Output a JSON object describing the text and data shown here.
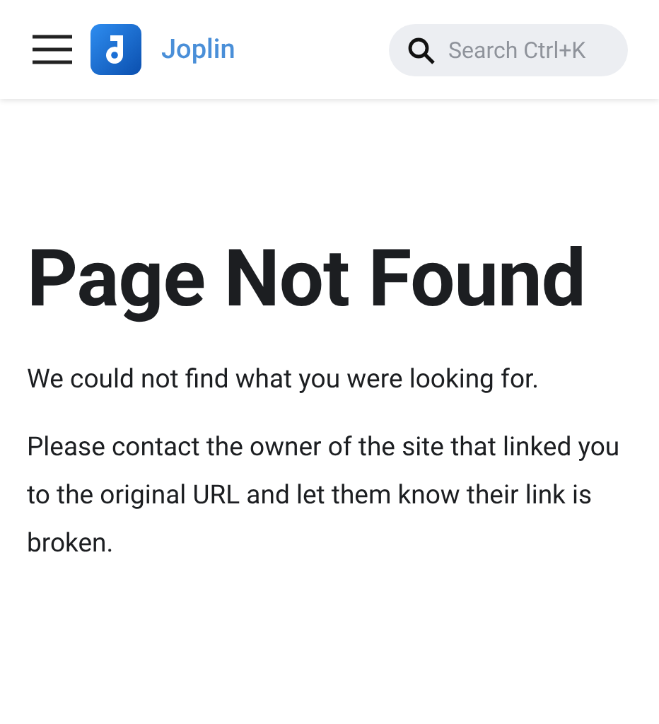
{
  "header": {
    "brand": "Joplin",
    "search": {
      "placeholder": "Search Ctrl+K"
    }
  },
  "title": "Page Not Found",
  "paragraphs": [
    "We could not find what you were looking for.",
    "Please contact the owner of the site that linked you to the original URL and let them know their link is broken."
  ]
}
